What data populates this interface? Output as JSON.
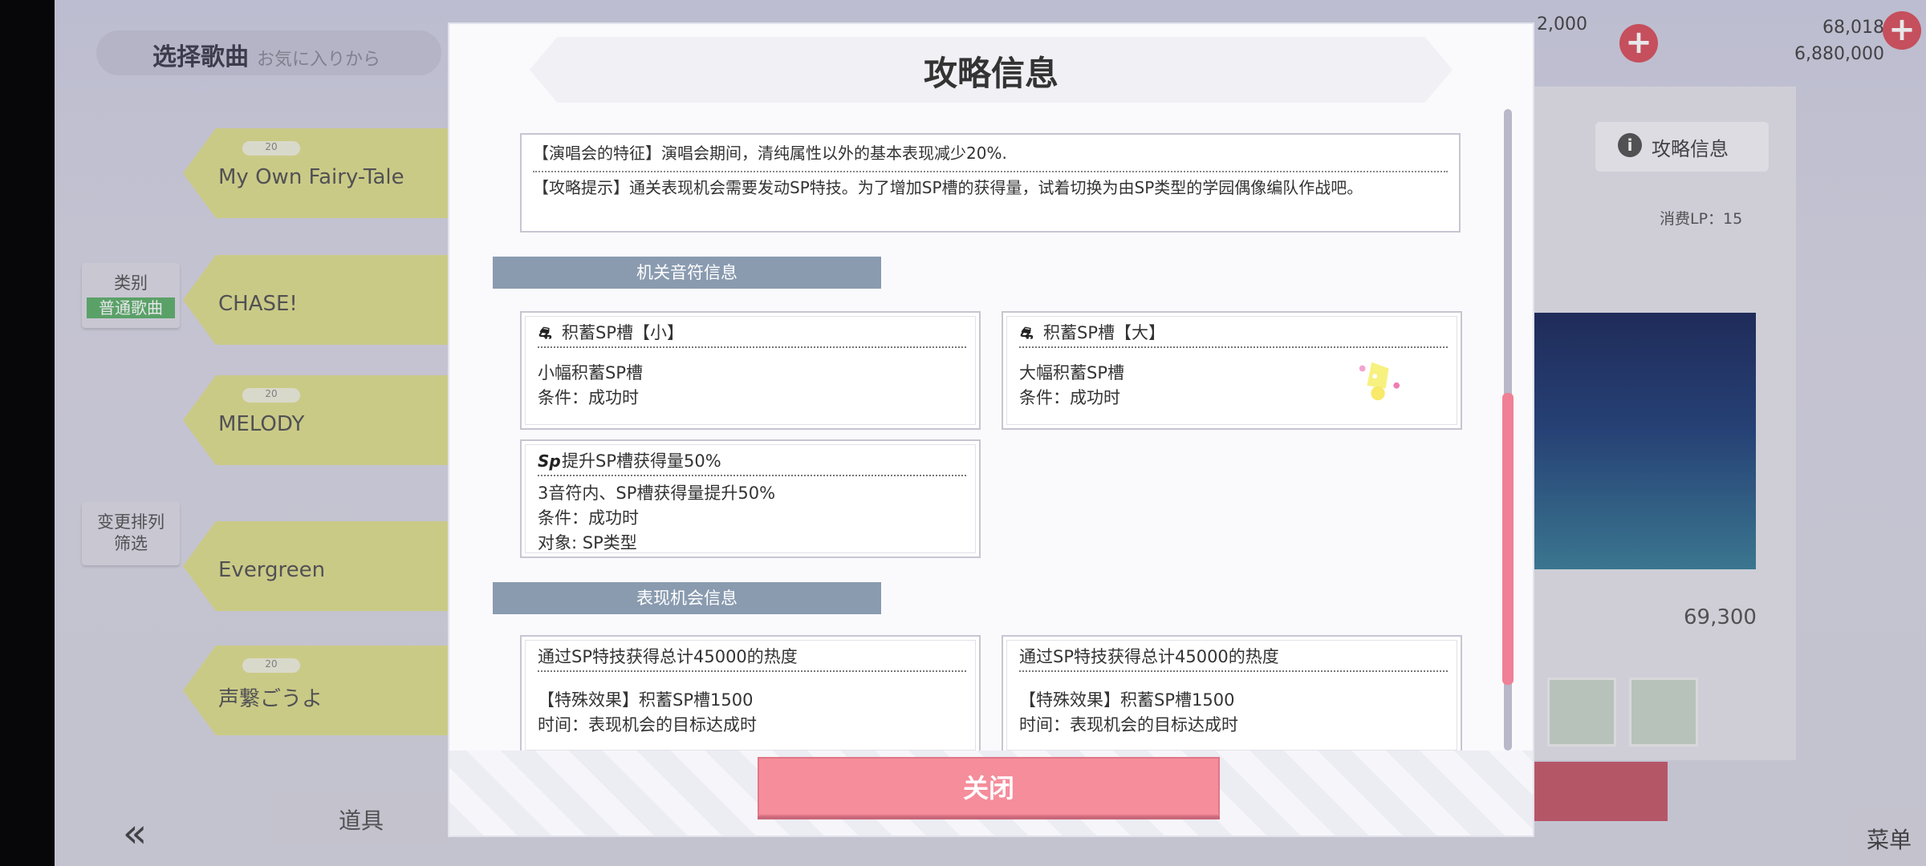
{
  "background": {
    "screen_title": "选择歌曲",
    "screen_subtitle": "お気に入りから",
    "songs": [
      {
        "level": "20",
        "name": "My Own Fairy-Tale"
      },
      {
        "level": "",
        "name": "CHASE!"
      },
      {
        "level": "20",
        "name": "MELODY"
      },
      {
        "level": "",
        "name": "Evergreen"
      },
      {
        "level": "20",
        "name": "声繋ごうよ"
      }
    ],
    "category_label": "类别",
    "category_value": "普通歌曲",
    "sort_filter_label": "变更排列\n筛选",
    "back_icon": "«",
    "tool_label": "道具",
    "strategy_info_label": "攻略信息",
    "lp_cost": "消费LP：15",
    "count": "69,300",
    "menu_label": "菜单",
    "currency_1": "2,000",
    "currency_2": "68,018\n6,880,000"
  },
  "modal": {
    "title": "攻略信息",
    "feature": {
      "line1": "【演唱会的特征】演唱会期间，清纯属性以外的基本表现减少20%.",
      "line2": "【攻略提示】通关表现机会需要发动SP特技。为了增加SP槽的获得量，试着切换为由SP类型的学园偶像编队作战吧。"
    },
    "gimmick_section": "机关音符信息",
    "gimmick_cards": [
      {
        "icon": "sp-gauge-icon",
        "title": "积蓄SP槽【小】",
        "line1": "小幅积蓄SP槽",
        "line2": "条件：成功时",
        "line3": ""
      },
      {
        "icon": "sp-gauge-icon",
        "title": "积蓄SP槽【大】",
        "line1": "大幅积蓄SP槽",
        "line2": "条件：成功时",
        "line3": ""
      },
      {
        "icon": "sp-icon",
        "title": "提升SP槽获得量50%",
        "line1": "3音符内、SP槽获得量提升50%",
        "line2": "条件：成功时",
        "line3": "对象: SP类型"
      }
    ],
    "icon_text": {
      "sp": "Sp",
      "gauge": "⛐"
    },
    "chance_section": "表现机会信息",
    "chance_cards": [
      {
        "title": "通过SP特技获得总计45000的热度",
        "line1": "【特殊效果】积蓄SP槽1500",
        "line2": "时间：表现机会的目标达成时"
      },
      {
        "title": "通过SP特技获得总计45000的热度",
        "line1": "【特殊效果】积蓄SP槽1500",
        "line2": "时间：表现机会的目标达成时"
      }
    ],
    "close_label": "关闭"
  },
  "colors": {
    "section_header": "#8a9bb0",
    "close_button": "#f58d9b",
    "scroll_thumb": "#f08095",
    "song_card": "#dedf8f"
  }
}
